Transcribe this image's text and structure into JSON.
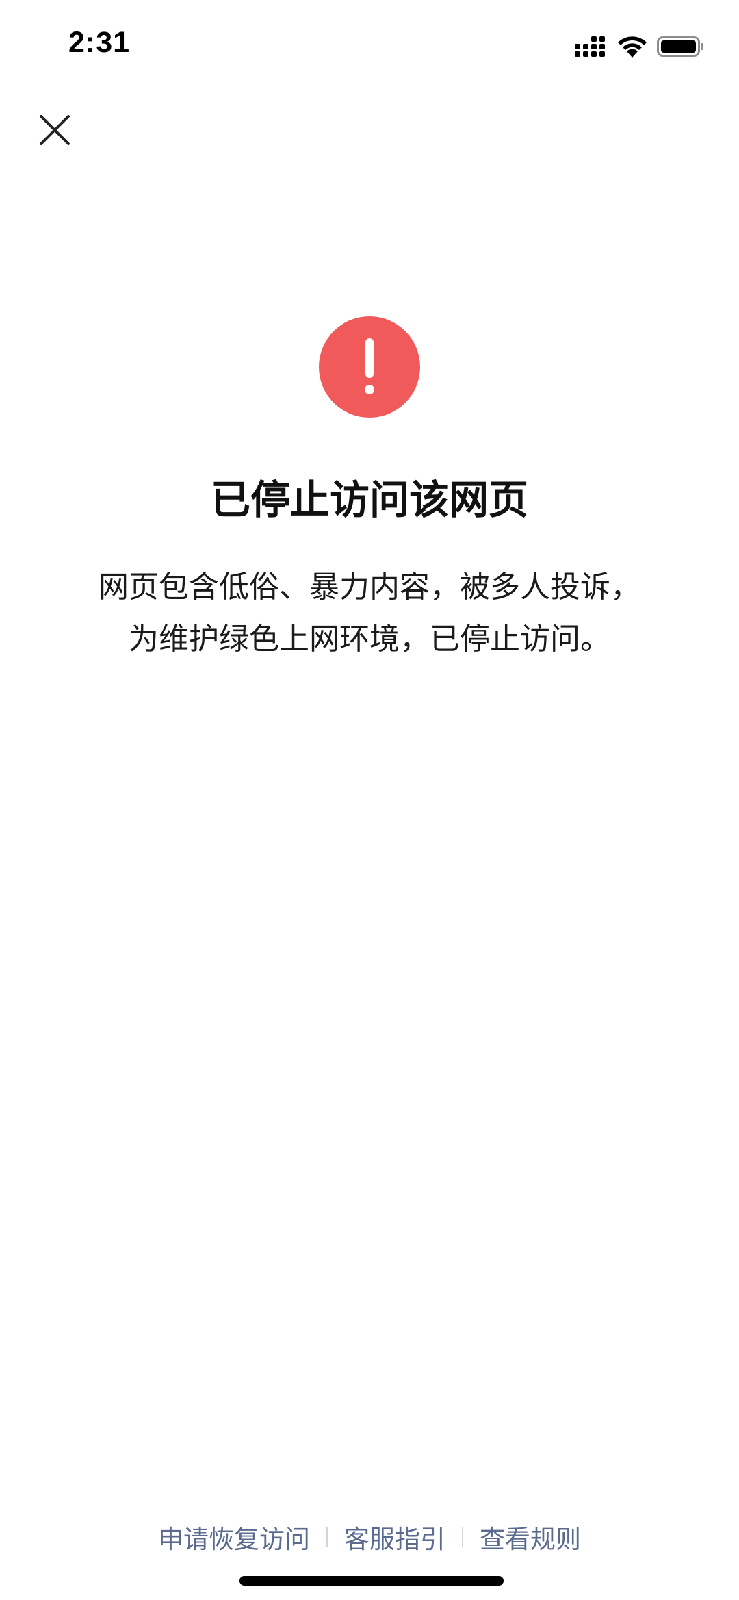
{
  "status_bar": {
    "time": "2:31",
    "signal_icon": "cellular-signal-icon",
    "wifi_icon": "wifi-icon",
    "battery_icon": "battery-icon"
  },
  "header": {
    "close_icon": "close-icon"
  },
  "notice": {
    "icon": "exclamation-circle-icon",
    "icon_color": "#f05a5a",
    "title": "已停止访问该网页",
    "description_line1": "网页包含低俗、暴力内容，被多人投诉，",
    "description_line2": "为维护绿色上网环境，已停止访问。"
  },
  "footer": {
    "link_color": "#5b6b8f",
    "links": [
      {
        "label": "申请恢复访问"
      },
      {
        "label": "客服指引"
      },
      {
        "label": "查看规则"
      }
    ]
  }
}
